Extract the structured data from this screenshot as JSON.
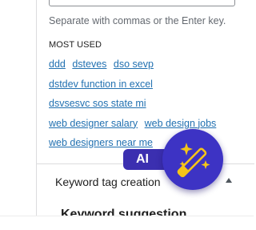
{
  "tags": {
    "hint": "Separate with commas or the Enter key.",
    "most_used_label": "MOST USED",
    "most_used": [
      "ddd",
      "dsteves",
      "dso sevp",
      "dstdev function in excel",
      "dsvsesvc sos state mi",
      "web designer salary",
      "web design jobs",
      "web designers near me"
    ]
  },
  "section": {
    "title": "Keyword tag creation",
    "subheading": "Keyword suggestion"
  },
  "ai_button": {
    "label": "AI",
    "icon": "magic-wand-icon"
  },
  "colors": {
    "link": "#2271b1",
    "ai_purple": "#3d33c4",
    "ai_pill": "#3b2fb0",
    "sparkle": "#f5c518"
  }
}
